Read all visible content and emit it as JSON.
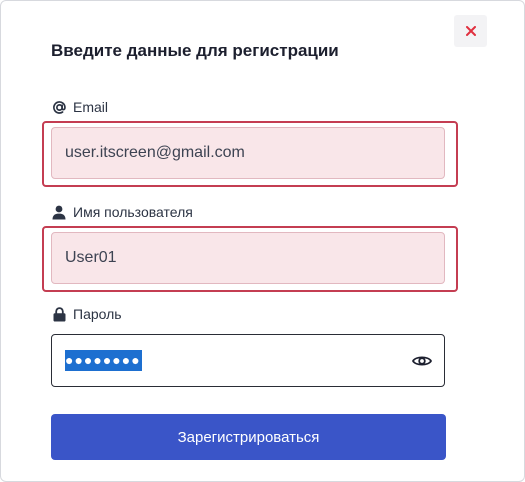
{
  "dialog": {
    "title": "Введите данные для регистрации",
    "close_icon": "close-icon",
    "close_color": "#e0303f"
  },
  "fields": {
    "email": {
      "label": "Email",
      "icon": "at-icon",
      "value": "user.itscreen@gmail.com",
      "state": "invalid"
    },
    "username": {
      "label": "Имя пользователя",
      "icon": "user-icon",
      "value": "User01",
      "state": "invalid"
    },
    "password": {
      "label": "Пароль",
      "icon": "lock-icon",
      "masked_value": "●●●●●●●●",
      "toggle_icon": "eye-icon"
    }
  },
  "submit": {
    "label": "Зарегистрироваться",
    "color": "#3a55c8"
  },
  "colors": {
    "error_border": "#c43d52",
    "error_fill": "#f9e6e9",
    "selection": "#1d6fd0"
  }
}
